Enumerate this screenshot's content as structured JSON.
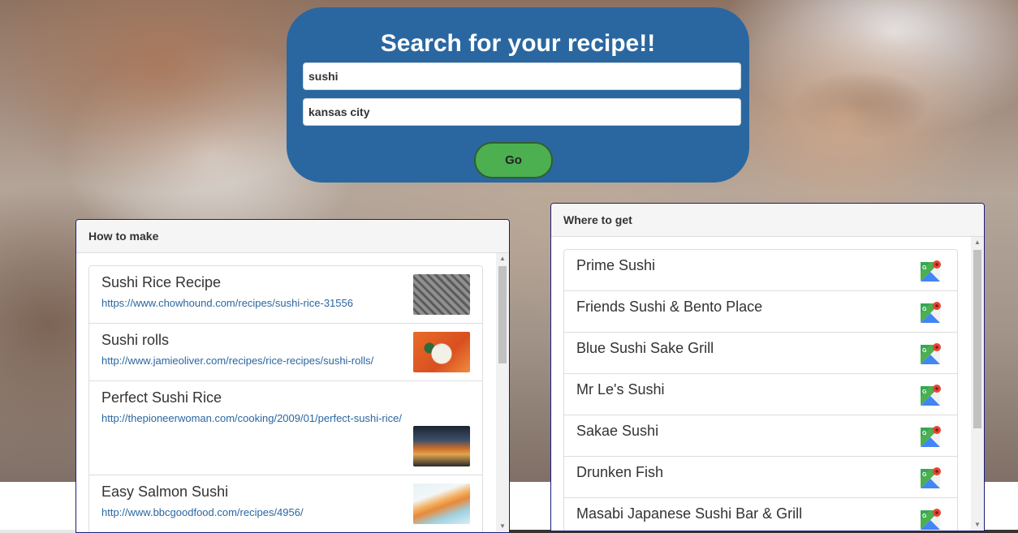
{
  "search": {
    "title": "Search for your recipe!!",
    "query_value": "sushi",
    "location_value": "kansas city",
    "go_label": "Go"
  },
  "how_to_make": {
    "header": "How to make",
    "recipes": [
      {
        "title": "Sushi Rice Recipe",
        "url": "https://www.chowhound.com/recipes/sushi-rice-31556"
      },
      {
        "title": "Sushi rolls",
        "url": "http://www.jamieoliver.com/recipes/rice-recipes/sushi-rolls/"
      },
      {
        "title": "Perfect Sushi Rice",
        "url": "http://thepioneerwoman.com/cooking/2009/01/perfect-sushi-rice/"
      },
      {
        "title": "Easy Salmon Sushi",
        "url": "http://www.bbcgoodfood.com/recipes/4956/"
      }
    ]
  },
  "where_to_get": {
    "header": "Where to get",
    "places": [
      {
        "name": "Prime Sushi",
        "icon": "google-maps-icon"
      },
      {
        "name": "Friends Sushi & Bento Place",
        "icon": "google-maps-icon"
      },
      {
        "name": "Blue Sushi Sake Grill",
        "icon": "google-maps-icon"
      },
      {
        "name": "Mr Le's Sushi",
        "icon": "google-maps-icon"
      },
      {
        "name": "Sakae Sushi",
        "icon": "google-maps-icon"
      },
      {
        "name": "Drunken Fish",
        "icon": "google-maps-icon"
      },
      {
        "name": "Masabi Japanese Sushi Bar & Grill",
        "icon": "google-maps-icon"
      }
    ]
  },
  "colors": {
    "search_panel": "#2a67a0",
    "go_button": "#4caf50",
    "link": "#2a67a0",
    "panel_border": "#1c1c7a"
  }
}
